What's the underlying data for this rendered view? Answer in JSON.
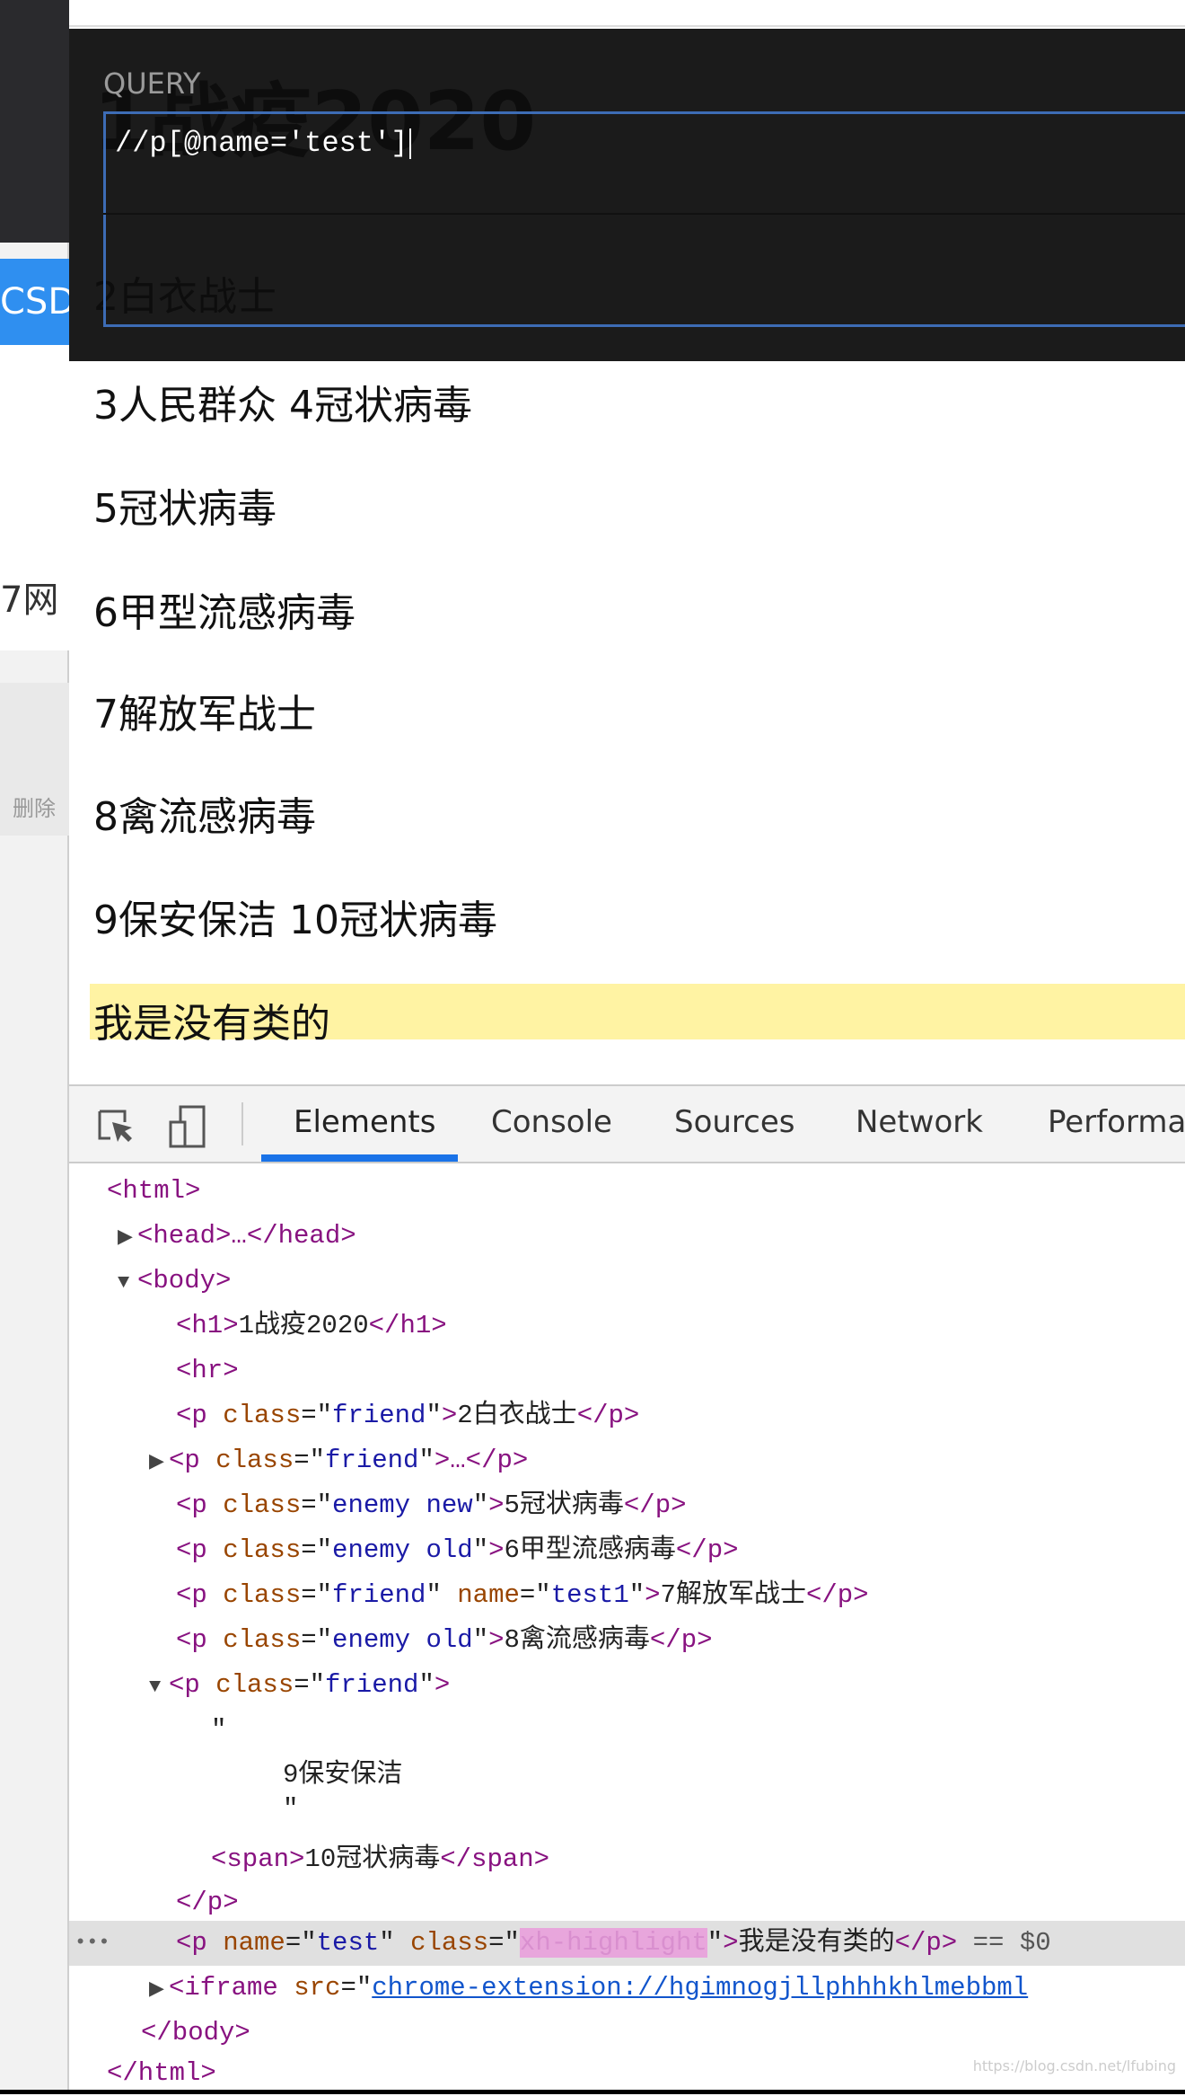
{
  "background_window": {
    "tab_fragment": "CSD",
    "text_fragment": "7网",
    "button_fragment": "删除"
  },
  "overlay": {
    "query_label": "QUERY",
    "query_value": "//p[@name='test']",
    "ghost_h1": "1战疫2020",
    "ghost_p": "2白衣战士"
  },
  "page": {
    "lines": [
      "3人民群众 4冠状病毒",
      "5冠状病毒",
      "6甲型流感病毒",
      "7解放军战士",
      "8禽流感病毒",
      "9保安保洁 10冠状病毒"
    ],
    "highlighted": "我是没有类的",
    "highlight_color": "#fff3a3"
  },
  "devtools": {
    "tabs": [
      "Elements",
      "Console",
      "Sources",
      "Network",
      "Performan"
    ],
    "active_tab": "Elements",
    "dom": {
      "html_open": "<html>",
      "head": "<head>…</head>",
      "body_open": "<body>",
      "h1_text": "1战疫2020",
      "p2_text": "2白衣战士",
      "p5_text": "5冠状病毒",
      "p6_text": "6甲型流感病毒",
      "p7_text": "7解放军战士",
      "p8_text": "8禽流感病毒",
      "p9_text": "9保安保洁",
      "span_text": "10冠状病毒",
      "sel_text": "我是没有类的",
      "class_friend": "friend",
      "class_enemy_new": "enemy new",
      "class_enemy_old": "enemy old",
      "name_test1": "test1",
      "name_test": "test",
      "class_highlight": "xh-highlight",
      "sel_suffix": "== $0",
      "iframe_src": "chrome-extension://hgimnogjllphhhkhlmebbml"
    }
  },
  "watermark": "https://blog.csdn.net/lfubing"
}
